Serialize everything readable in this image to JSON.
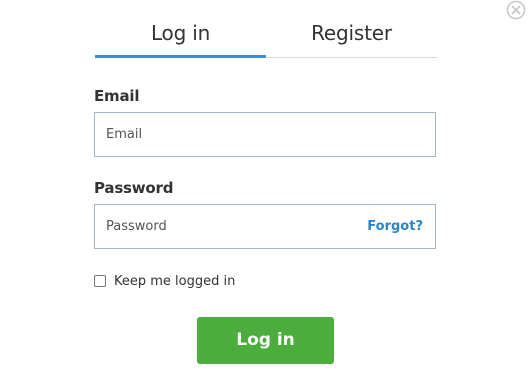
{
  "tabs": {
    "login_label": "Log in",
    "register_label": "Register",
    "active": "login",
    "accent_color": "#3a8fd6"
  },
  "form": {
    "email_label": "Email",
    "email_placeholder": "Email",
    "email_value": "",
    "password_label": "Password",
    "password_placeholder": "Password",
    "password_value": "",
    "forgot_label": "Forgot?",
    "remember_label": "Keep me logged in",
    "remember_checked": false,
    "submit_label": "Log in",
    "submit_color": "#4bad3b",
    "link_color": "#2d86c9"
  },
  "icons": {
    "close": "close-icon"
  }
}
